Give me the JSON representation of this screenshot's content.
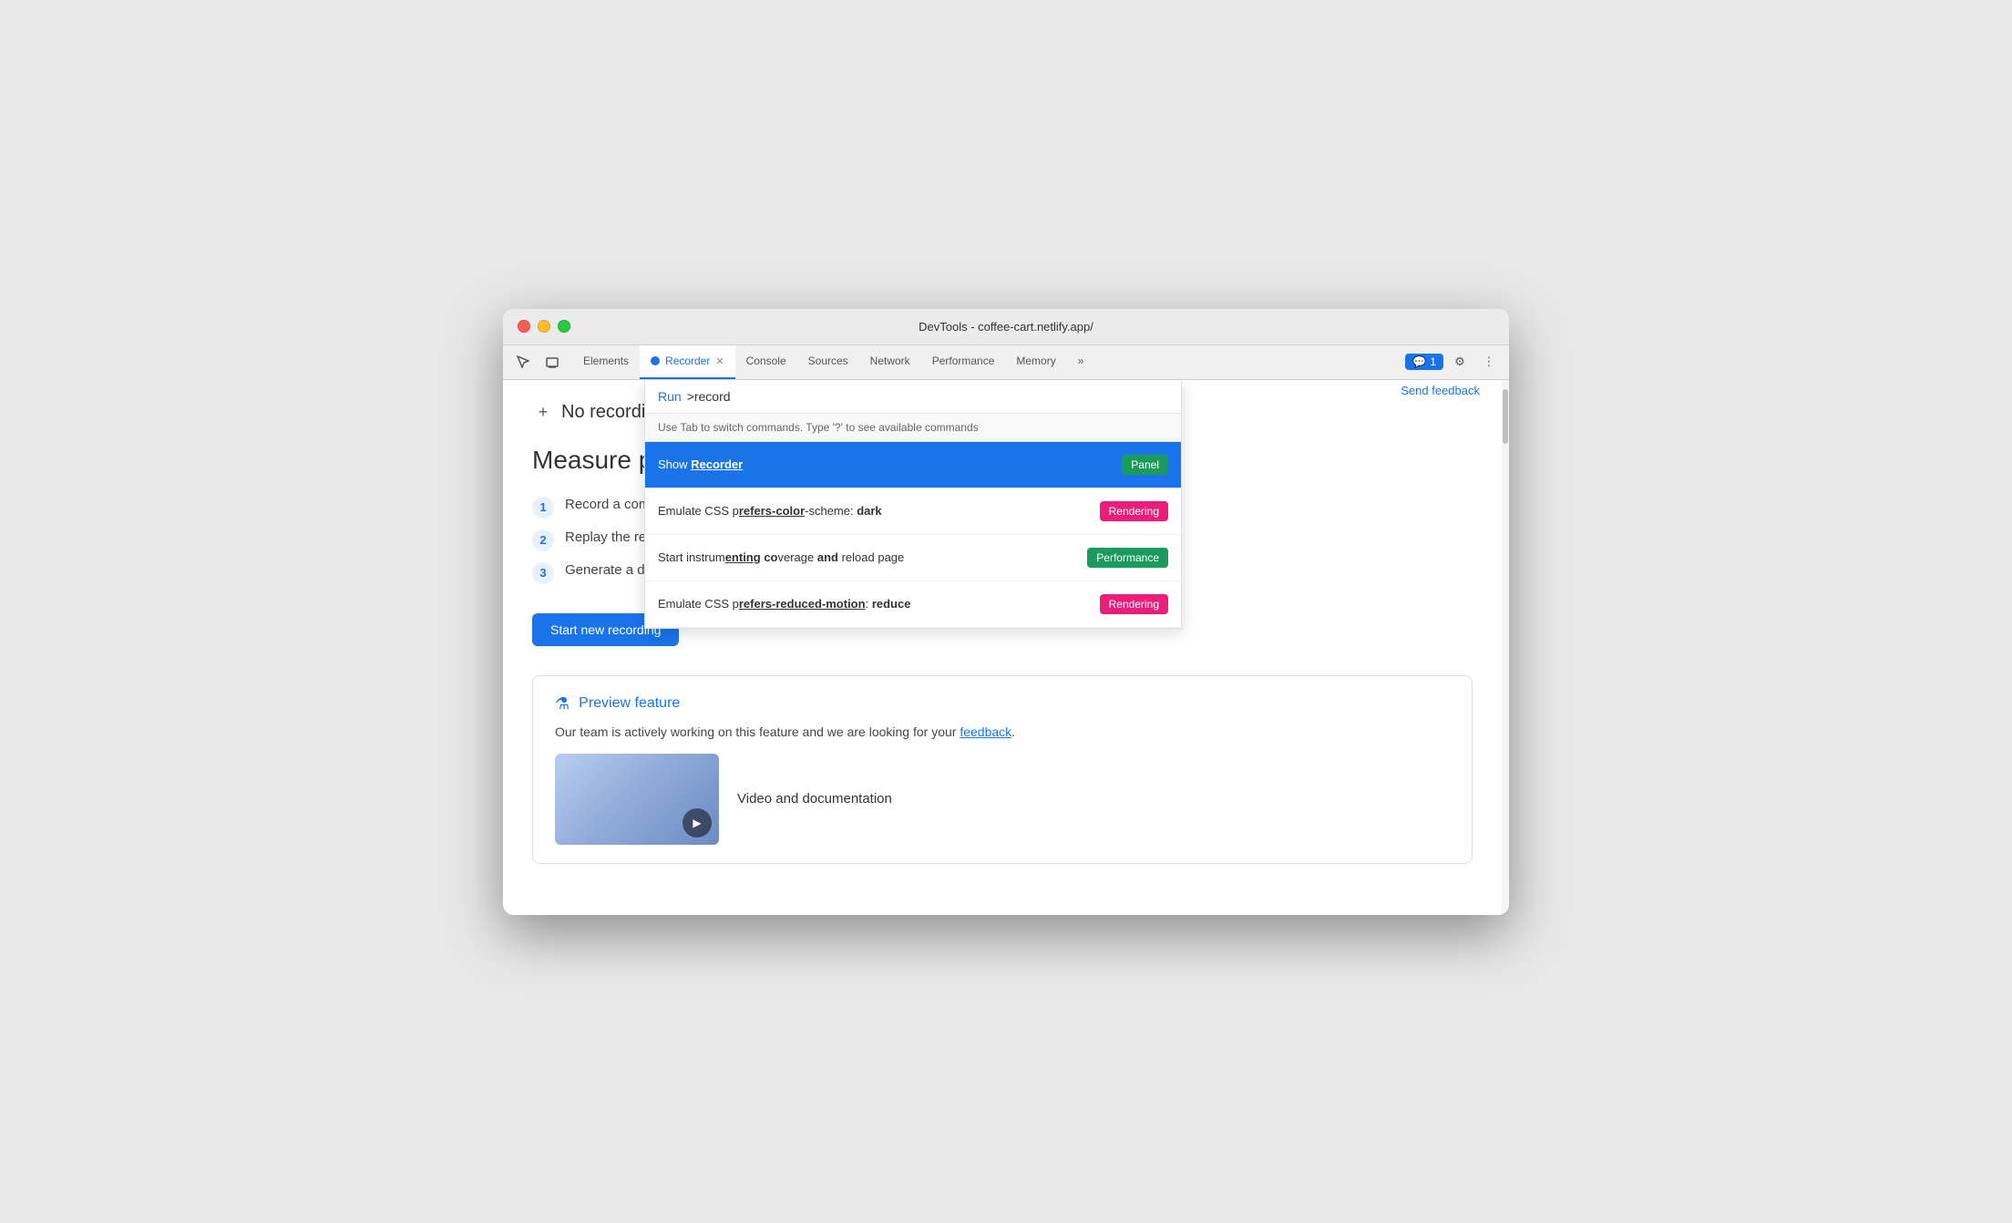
{
  "window": {
    "title": "DevTools - coffee-cart.netlify.app/"
  },
  "tabs": {
    "items": [
      {
        "label": "Elements",
        "active": false,
        "closable": false
      },
      {
        "label": "Recorder",
        "active": true,
        "closable": true
      },
      {
        "label": "Console",
        "active": false,
        "closable": false
      },
      {
        "label": "Sources",
        "active": false,
        "closable": false
      },
      {
        "label": "Network",
        "active": false,
        "closable": false
      },
      {
        "label": "Performance",
        "active": false,
        "closable": false
      },
      {
        "label": "Memory",
        "active": false,
        "closable": false
      }
    ],
    "more_label": "»",
    "feedback_count": "1",
    "feedback_icon": "💬"
  },
  "recorder": {
    "no_recordings": "No recordings",
    "add_label": "+",
    "send_feedback": "Send feedback",
    "measure_title": "Measure perfo",
    "steps": [
      {
        "num": "1",
        "text": "Record a comr"
      },
      {
        "num": "2",
        "text": "Replay the rec"
      },
      {
        "num": "3",
        "text": "Generate a det"
      }
    ],
    "start_button": "Start new recording"
  },
  "preview": {
    "title": "Preview feature",
    "flask_icon": "⚗",
    "body_text": "Our team is actively working on this feature and we are looking for your",
    "feedback_link": "feedback",
    "period": ".",
    "video_doc_label": "Video and documentation"
  },
  "command_palette": {
    "run_label": "Run",
    "input_value": ">record",
    "hint": "Use Tab to switch commands. Type '?' to see available commands",
    "items": [
      {
        "text_before": "Show ",
        "match": "Recorder",
        "text_after": "",
        "badge_label": "Panel",
        "badge_class": "badge-panel",
        "active": true
      },
      {
        "text_before": "Emulate CSS p",
        "match": "refers-color",
        "text_after": "-scheme: dark",
        "badge_label": "Rendering",
        "badge_class": "badge-rendering",
        "active": false
      },
      {
        "text_before": "Start instrum",
        "match": "enting co",
        "text_after": "verage and reload page",
        "badge_label": "Performance",
        "badge_class": "badge-performance",
        "active": false
      },
      {
        "text_before": "Emulate CSS p",
        "match": "refers-reduced-motion",
        "text_after": ": reduce",
        "badge_label": "Rendering",
        "badge_class": "badge-rendering",
        "active": false
      }
    ]
  },
  "colors": {
    "accent": "#1a73e8",
    "panel_badge": "#1a9b5c",
    "rendering_badge": "#e91e7a",
    "performance_badge": "#1a9b5c"
  }
}
